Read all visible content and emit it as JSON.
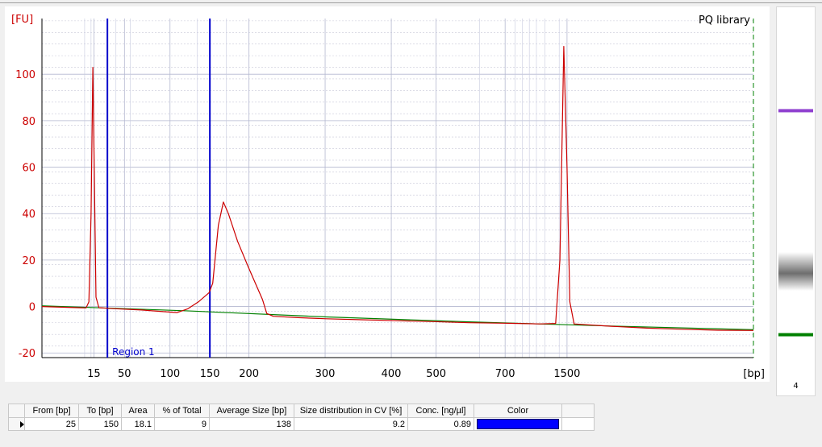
{
  "chart_data": {
    "type": "line",
    "title": "PQ library",
    "ylabel": "[FU]",
    "xlabel": "[bp]",
    "ylim": [
      -22,
      124
    ],
    "y_ticks": [
      -20,
      0,
      20,
      40,
      60,
      80,
      100
    ],
    "x_ticks": [
      "15",
      "50",
      "100",
      "150",
      "200",
      "300",
      "400",
      "500",
      "700",
      "1500"
    ],
    "x_tick_labels": [
      {
        "label": "15",
        "pos": 0.073
      },
      {
        "label": "50",
        "pos": 0.116
      },
      {
        "label": "100",
        "pos": 0.18
      },
      {
        "label": "150",
        "pos": 0.236
      },
      {
        "label": "200",
        "pos": 0.291
      },
      {
        "label": "300",
        "pos": 0.398
      },
      {
        "label": "400",
        "pos": 0.491
      },
      {
        "label": "500",
        "pos": 0.554
      },
      {
        "label": "700",
        "pos": 0.651
      },
      {
        "label": "1500",
        "pos": 0.738
      }
    ],
    "x_domain": [
      0,
      1
    ],
    "series": [
      {
        "color": "#cc0000",
        "points": [
          [
            0,
            0
          ],
          [
            0.05,
            -0.5
          ],
          [
            0.062,
            -0.6
          ],
          [
            0.066,
            2
          ],
          [
            0.069,
            40
          ],
          [
            0.0715,
            103
          ],
          [
            0.0735,
            60
          ],
          [
            0.076,
            4
          ],
          [
            0.08,
            -0.5
          ],
          [
            0.1,
            -0.9
          ],
          [
            0.14,
            -1.5
          ],
          [
            0.17,
            -2.2
          ],
          [
            0.19,
            -2.6
          ],
          [
            0.205,
            -1
          ],
          [
            0.22,
            2
          ],
          [
            0.235,
            6
          ],
          [
            0.24,
            10
          ],
          [
            0.248,
            35
          ],
          [
            0.255,
            45
          ],
          [
            0.262,
            40
          ],
          [
            0.275,
            28
          ],
          [
            0.29,
            17
          ],
          [
            0.3,
            10
          ],
          [
            0.31,
            3
          ],
          [
            0.316,
            -3
          ],
          [
            0.325,
            -4.2
          ],
          [
            0.36,
            -4.8
          ],
          [
            0.4,
            -5.3
          ],
          [
            0.45,
            -5.7
          ],
          [
            0.5,
            -6.1
          ],
          [
            0.55,
            -6.5
          ],
          [
            0.6,
            -7
          ],
          [
            0.65,
            -7.2
          ],
          [
            0.7,
            -7.5
          ],
          [
            0.722,
            -7.3
          ],
          [
            0.728,
            20
          ],
          [
            0.7335,
            112
          ],
          [
            0.738,
            60
          ],
          [
            0.742,
            2
          ],
          [
            0.748,
            -7.5
          ],
          [
            0.8,
            -8.5
          ],
          [
            0.85,
            -9.3
          ],
          [
            0.9,
            -9.8
          ],
          [
            0.95,
            -10.2
          ],
          [
            1,
            -10.3
          ]
        ]
      },
      {
        "color": "#008000",
        "points": [
          [
            0,
            0.3
          ],
          [
            0.2,
            -1.8
          ],
          [
            0.4,
            -4.5
          ],
          [
            0.6,
            -6.6
          ],
          [
            0.8,
            -8.4
          ],
          [
            1,
            -10
          ]
        ]
      }
    ],
    "region": {
      "label": "Region 1",
      "from_pos": 0.092,
      "to_pos": 0.236,
      "color": "#0000cc"
    },
    "grid": true
  },
  "gel": {
    "lane_label": "4",
    "bands": [
      {
        "pos": 0.278,
        "color": "#9040d0"
      },
      {
        "pos": 0.71,
        "color": "#888888"
      },
      {
        "pos": 0.88,
        "color": "#008000"
      }
    ]
  },
  "table": {
    "headers": [
      "From [bp]",
      "To [bp]",
      "Area",
      "% of Total",
      "Average Size [bp]",
      "Size distribution in CV [%]",
      "Conc. [ng/µl]",
      "Color"
    ],
    "rows": [
      {
        "from": "25",
        "to": "150",
        "area": "18.1",
        "pct": "9",
        "avg": "138",
        "cv": "9.2",
        "conc": "0.89",
        "color": "#0000ff"
      }
    ]
  }
}
